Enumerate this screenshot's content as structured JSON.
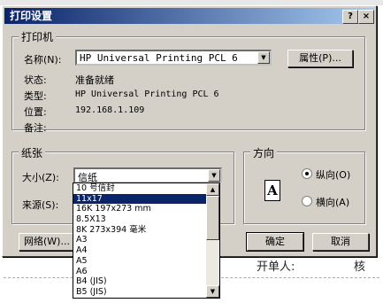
{
  "dialog": {
    "title": "打印设置",
    "help_icon_label": "?",
    "close_icon_label": "×"
  },
  "printer": {
    "group_label": "打印机",
    "name_label": "名称(N):",
    "name_value": "HP Universal Printing PCL 6",
    "properties_button": "属性(P)...",
    "status_label": "状态:",
    "status_value": "准备就绪",
    "type_label": "类型:",
    "type_value": "HP Universal Printing PCL 6",
    "location_label": "位置:",
    "location_value": "192.168.1.109",
    "comment_label": "备注:",
    "comment_value": ""
  },
  "paper": {
    "group_label": "纸张",
    "size_label": "大小(Z):",
    "size_value": "信纸",
    "source_label": "来源(S):",
    "size_options": [
      "10 号信封",
      "11x17",
      "16K 197x273 mm",
      "8.5X13",
      "8K 273x394 毫米",
      "A3",
      "A4",
      "A5",
      "A6",
      "B4 (JIS)",
      "B5 (JIS)"
    ],
    "selected_option": "11x17"
  },
  "orientation": {
    "group_label": "方向",
    "portrait_label": "纵向(O)",
    "landscape_label": "横向(A)",
    "selected": "portrait",
    "icon_letter": "A"
  },
  "buttons": {
    "network": "网络(W)...",
    "ok": "确定",
    "cancel": "取消"
  },
  "background": {
    "doc_fragment_1": "开单人:",
    "doc_fragment_2": "核"
  }
}
